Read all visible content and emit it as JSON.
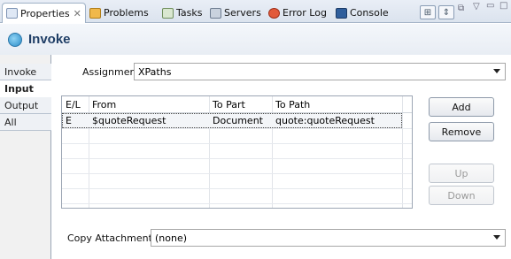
{
  "tabs": [
    {
      "label": "Properties",
      "icon": "properties-icon",
      "active": true,
      "closable": true
    },
    {
      "label": "Problems",
      "icon": "problems-icon"
    },
    {
      "label": "Tasks",
      "icon": "tasks-icon"
    },
    {
      "label": "Servers",
      "icon": "servers-icon"
    },
    {
      "label": "Error Log",
      "icon": "error-log-icon"
    },
    {
      "label": "Console",
      "icon": "console-icon"
    }
  ],
  "title": "Invoke",
  "side_tabs": [
    "Invoke",
    "Input",
    "Output",
    "All"
  ],
  "active_side_tab": "Input",
  "assignment": {
    "label": "Assignment",
    "value": "XPaths"
  },
  "table": {
    "columns": [
      "E/L",
      "From",
      "To Part",
      "To Path"
    ],
    "rows": [
      {
        "el": "E",
        "from": "$quoteRequest",
        "to_part": "Document",
        "to_path": "quote:quoteRequest"
      }
    ]
  },
  "buttons": {
    "add": "Add",
    "remove": "Remove",
    "up": "Up",
    "down": "Down"
  },
  "copy_attachments": {
    "label": "Copy Attachments:",
    "value": "(none)"
  },
  "colors": {
    "title_text": "#1f3e66",
    "border": "#9ca6b4"
  }
}
